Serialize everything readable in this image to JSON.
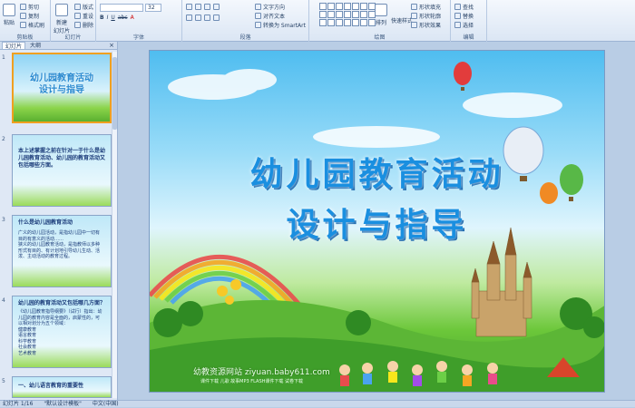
{
  "ribbon": {
    "clipboard": {
      "label": "剪贴板",
      "paste": "粘贴",
      "cut": "剪切",
      "copy": "复制",
      "format_painter": "格式刷"
    },
    "slides": {
      "label": "幻灯片",
      "new_slide": "新建\n幻灯片",
      "layout": "版式",
      "reset": "重设",
      "delete": "删除"
    },
    "font": {
      "label": "字体",
      "size": "32"
    },
    "paragraph": {
      "label": "段落",
      "text_direction": "文字方向",
      "align_text": "对齐文本",
      "smartart": "转换为 SmartArt"
    },
    "drawing": {
      "label": "绘图",
      "arrange": "排列",
      "quick_styles": "快速样式",
      "shape_fill": "形状填充",
      "shape_outline": "形状轮廓",
      "shape_effects": "形状效果"
    },
    "editing": {
      "label": "编辑",
      "find": "查找",
      "replace": "替换",
      "select": "选择"
    }
  },
  "pane": {
    "tab_slides": "幻灯片",
    "tab_outline": "大纲",
    "close": "×",
    "slides": [
      {
        "num": "1",
        "title": "幼儿园教育活动\n设计与指导"
      },
      {
        "num": "2",
        "title": "本上述掌握之前在针对一于什么是幼儿园教育活动、幼儿园的教育活动又包括哪些方面。"
      },
      {
        "num": "3",
        "title": "什么是幼儿园教育活动",
        "body": "广义的幼儿园活动，是指幼儿园中一切有目的有意义的活动……\n狭义的幼儿园教育活动，是指教师以多种形式有目的、有计划地引导幼儿生动、活泼、主动活动的教育过程。"
      },
      {
        "num": "4",
        "title": "幼儿园的教育活动又包括哪几方面？",
        "body": "《幼儿园教育指导纲要》（试行）指出：幼儿园的教育内容是全面的，启蒙性的，可以相对划分为五个领域：\n健康教育\n语言教育\n科学教育\n社会教育\n艺术教育"
      },
      {
        "num": "5",
        "title": "一、幼儿语言教育的重要性"
      }
    ]
  },
  "slide": {
    "title_line1": "幼儿园教育活动",
    "title_line2": "设计与指导",
    "watermark": "幼教资源网站  ziyuan.baby611.com",
    "watermark_sub": "课件下载  儿歌  故事MP3  FLASH课件下载  试卷下载"
  },
  "status": {
    "slide_counter": "幻灯片 1/16",
    "theme": "\"默认设计模板\"",
    "language": "中文(中国)"
  }
}
